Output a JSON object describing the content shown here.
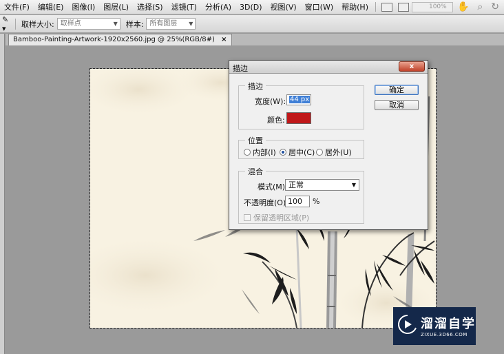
{
  "menubar": {
    "items": [
      "文件(F)",
      "编辑(E)",
      "图像(I)",
      "图层(L)",
      "选择(S)",
      "滤镜(T)",
      "分析(A)",
      "3D(D)",
      "视图(V)",
      "窗口(W)",
      "帮助(H)"
    ],
    "zoom": "100%",
    "icons": [
      "bridge-icon",
      "arrange-icon",
      "hand-tool-icon",
      "zoom-tool-icon",
      "rotate-view-icon"
    ]
  },
  "options": {
    "tool_glyph": "✎ ▾",
    "sample_size_label": "取样大小:",
    "sample_size_value": "取样点",
    "sample_label": "样本:",
    "sample_value": "所有图层"
  },
  "document": {
    "tab_title": "Bamboo-Painting-Artwork-1920x2560.jpg @ 25%(RGB/8#)",
    "close": "×",
    "colors": {
      "paper": "#f8f2e2",
      "ink": "#1e1e1e"
    }
  },
  "dialog": {
    "title": "描边",
    "close": "x",
    "stroke_section": "描边",
    "width_label": "宽度(W):",
    "width_value": "44 px",
    "color_label": "颜色:",
    "color_value": "#c0181a",
    "position_section": "位置",
    "position_options": [
      "内部(I)",
      "居中(C)",
      "居外(U)"
    ],
    "position_selected": 1,
    "blend_section": "混合",
    "mode_label": "模式(M):",
    "mode_value": "正常",
    "opacity_label": "不透明度(O):",
    "opacity_value": "100",
    "opacity_unit": "%",
    "preserve_transparency": "保留透明区域(P)",
    "ok": "确定",
    "cancel": "取消"
  },
  "watermark": {
    "name": "溜溜自学",
    "url": "ZIXUE.3D66.COM",
    "colors": {
      "bg": "#14284a"
    }
  }
}
